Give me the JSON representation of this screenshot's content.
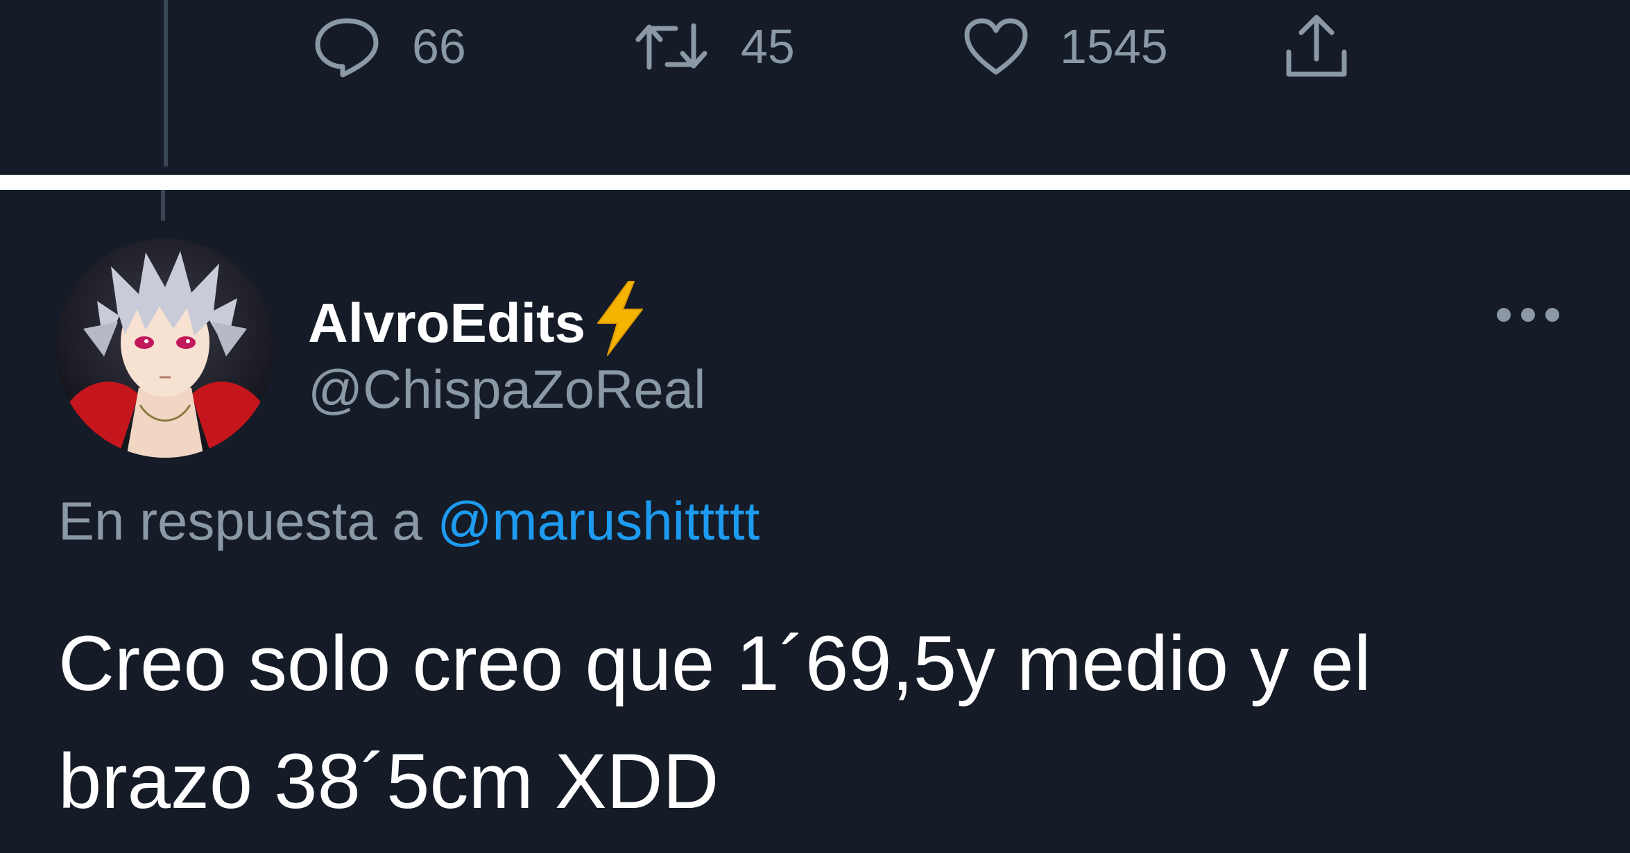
{
  "top_tweet": {
    "actions": {
      "replies": "66",
      "retweets": "45",
      "likes": "1545"
    }
  },
  "reply": {
    "display_name": "AlvroEdits",
    "name_emoji": "high-voltage-icon",
    "handle": "@ChispaZoReal",
    "reply_context_prefix": "En respuesta a",
    "reply_to": "@marushittttt",
    "text": "Creo solo creo que 1´69,5y medio y el brazo 38´5cm XDD"
  },
  "colors": {
    "background": "#151c28",
    "muted_text": "#8b98a5",
    "link": "#1d9bf0",
    "primary_text": "#ffffff",
    "divider": "#ffffff"
  }
}
